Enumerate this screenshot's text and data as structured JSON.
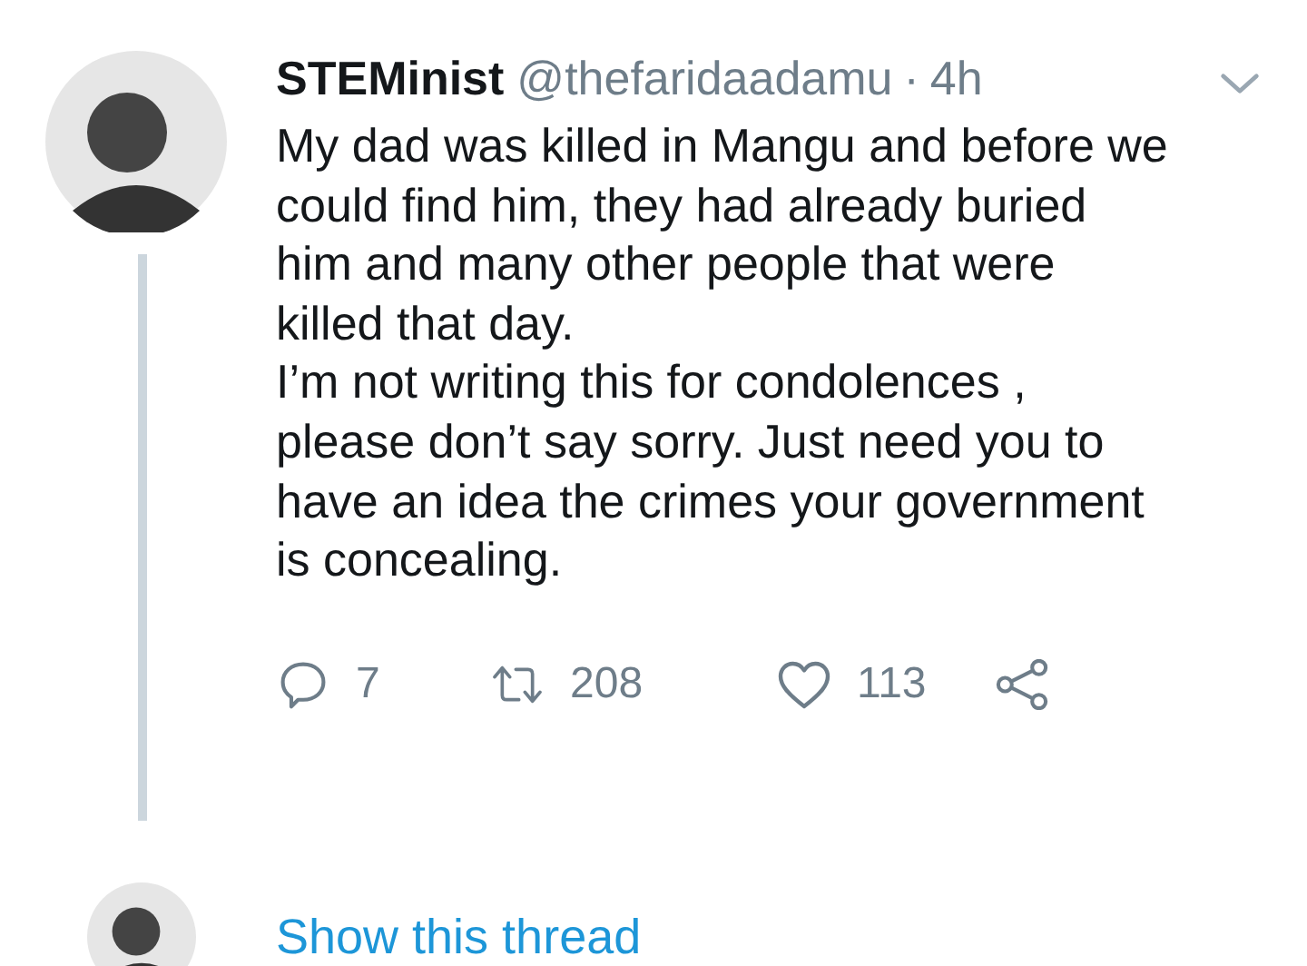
{
  "tweet": {
    "display_name": "STEMinist",
    "handle": "@thefaridaadamu",
    "separator": "·",
    "time": "4h",
    "paragraphs": [
      "My dad was killed in Mangu and before we could find him, they had already buried him and many other people that were killed that day.",
      "I’m not writing this for condolences , please don’t say sorry. Just need you to have an idea the crimes your government is concealing."
    ],
    "actions": [
      {
        "kind": "reply",
        "count": "7"
      },
      {
        "kind": "retweet",
        "count": "208"
      },
      {
        "kind": "like",
        "count": "113"
      },
      {
        "kind": "share"
      }
    ]
  },
  "thread_link": "Show this thread"
}
